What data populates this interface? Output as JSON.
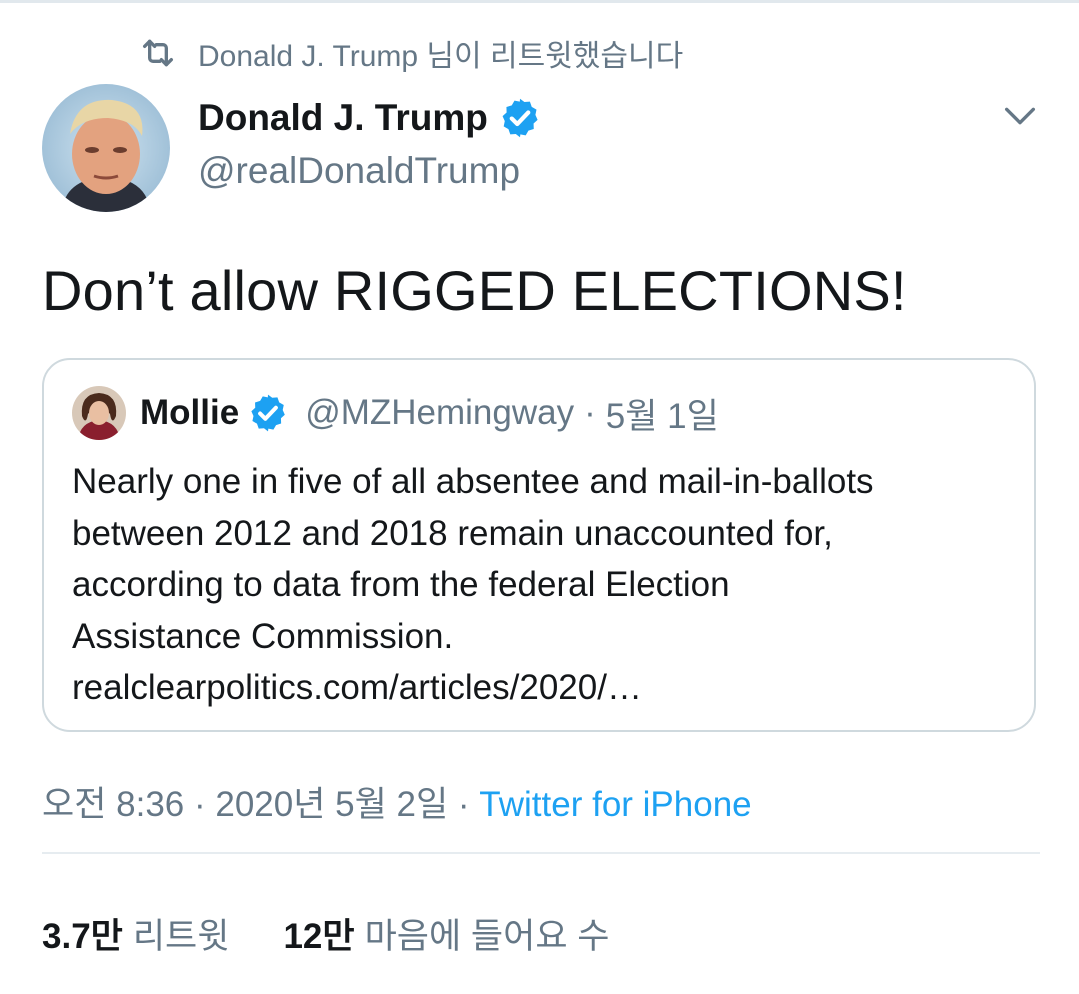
{
  "retweet_context": {
    "icon": "retweet-icon",
    "text": "Donald J. Trump 님이 리트윗했습니다"
  },
  "tweet": {
    "author_name": "Donald J. Trump",
    "author_handle": "@realDonaldTrump",
    "verified": true,
    "text": "Don’t allow RIGGED ELECTIONS!",
    "timestamp": "오전 8:36 · 2020년 5월 2일 · ",
    "source": "Twitter for iPhone"
  },
  "quote": {
    "author_name": "Mollie",
    "author_handle": "@MZHemingway",
    "separator": "·",
    "date": "5월 1일",
    "lines": [
      "Nearly one in five of all absentee and mail-in-ballots",
      "between 2012 and 2018 remain unaccounted for,",
      "according to data from the federal Election",
      "Assistance Commission.",
      "realclearpolitics.com/articles/2020/…"
    ]
  },
  "stats": {
    "retweets_count": "3.7만",
    "retweets_label": "리트윗",
    "likes_count": "12만",
    "likes_label": "마음에 들어요 수"
  },
  "colors": {
    "text_primary": "#14171a",
    "text_secondary": "#657786",
    "accent": "#1da1f2",
    "border": "#cfd9de"
  }
}
